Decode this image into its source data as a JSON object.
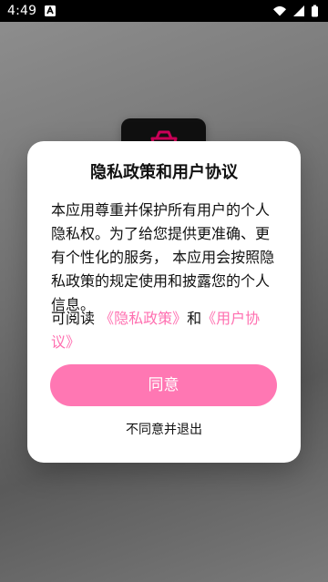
{
  "status_bar": {
    "time": "4:49",
    "left_icon": "a-box-icon",
    "right_icons": [
      "wifi-icon",
      "cellular-icon",
      "battery-icon"
    ]
  },
  "dialog": {
    "title": "隐私政策和用户协议",
    "body": "本应用尊重并保护所有用户的个人\n隐私权。为了给您提供更准确、更\n有个性化的服务， 本应用会按照隐\n私政策的规定使用和披露您的个人\n信息。",
    "read_prefix": "可阅读 ",
    "privacy_link": "《隐私政策》",
    "and_text": "和",
    "terms_link": "《用户协议》",
    "agree_label": "同意",
    "decline_label": "不同意并退出"
  },
  "colors": {
    "accent": "#ff77b3",
    "link": "#ff6fb0",
    "dialog_bg": "#ffffff",
    "status_bar_bg": "#000000"
  }
}
